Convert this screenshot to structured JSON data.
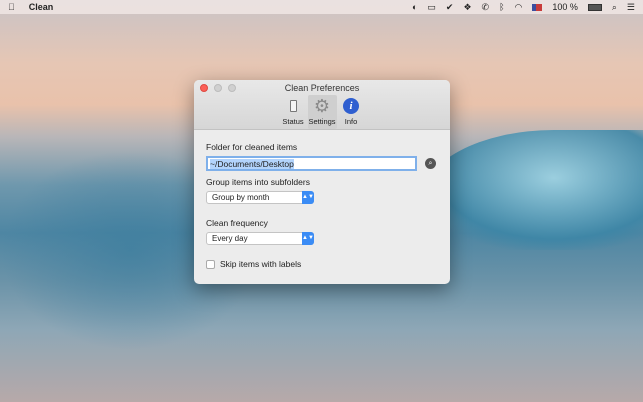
{
  "menubar": {
    "app_name": "Clean",
    "battery": "100 %"
  },
  "window": {
    "title": "Clean Preferences",
    "tabs": [
      {
        "label": "Status"
      },
      {
        "label": "Settings"
      },
      {
        "label": "Info"
      }
    ],
    "folder_label": "Folder for cleaned items",
    "folder_value": "~/Documents/Desktop",
    "group_label": "Group items into subfolders",
    "group_value": "Group by month",
    "freq_label": "Clean frequency",
    "freq_value": "Every day",
    "skip_label": "Skip items with labels"
  }
}
